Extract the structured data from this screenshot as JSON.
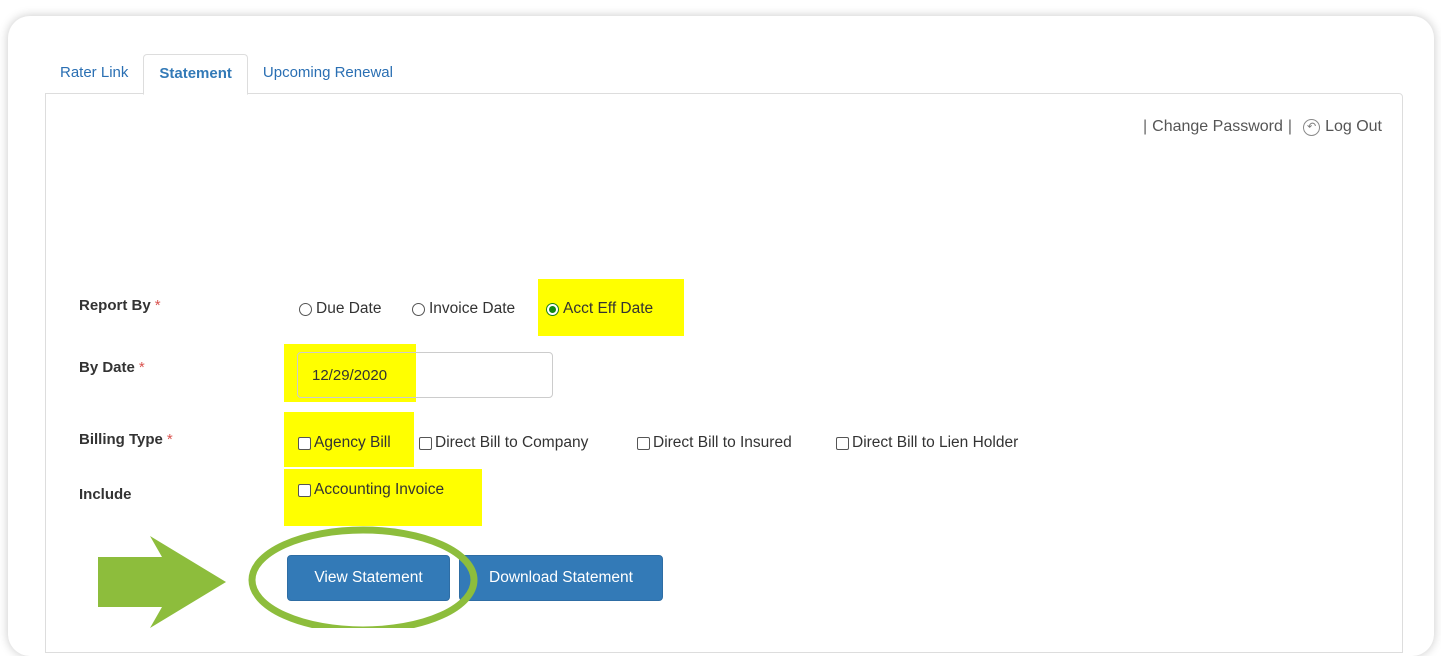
{
  "tabs": [
    {
      "label": "Rater Link",
      "active": false
    },
    {
      "label": "Statement",
      "active": true
    },
    {
      "label": "Upcoming Renewal",
      "active": false
    }
  ],
  "account_links": {
    "separator": "|",
    "change_password": "Change Password",
    "logout_icon": "logout-icon",
    "log_out": "Log Out"
  },
  "form": {
    "report_by": {
      "label": "Report By",
      "required_mark": "*",
      "options": [
        {
          "label": "Due Date",
          "checked": false
        },
        {
          "label": "Invoice Date",
          "checked": false
        },
        {
          "label": "Acct Eff Date",
          "checked": true
        }
      ]
    },
    "by_date": {
      "label": "By Date",
      "required_mark": "*",
      "value": "12/29/2020"
    },
    "billing_type": {
      "label": "Billing Type",
      "required_mark": "*",
      "options": [
        {
          "label": "Agency Bill",
          "checked": false
        },
        {
          "label": "Direct Bill to Company",
          "checked": false
        },
        {
          "label": "Direct Bill to Insured",
          "checked": false
        },
        {
          "label": "Direct Bill to Lien Holder",
          "checked": false
        }
      ]
    },
    "include": {
      "label": "Include",
      "options": [
        {
          "label": "Accounting Invoice",
          "checked": false
        }
      ]
    }
  },
  "buttons": {
    "view_statement": "View Statement",
    "download_statement": "Download Statement"
  },
  "colors": {
    "highlight": "#ffff00",
    "primary_button": "#337ab7",
    "annotation_green": "#8dbd3c",
    "required": "#d9534f"
  }
}
